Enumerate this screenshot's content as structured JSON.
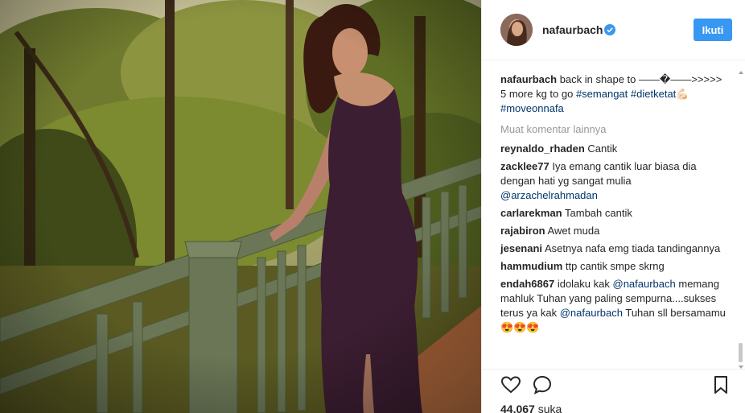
{
  "post": {
    "username": "nafaurbach",
    "follow_label": "Ikuti",
    "likes_count": "44,067",
    "likes_label": "suka"
  },
  "caption": {
    "user": "nafaurbach",
    "text": "back in shape to ——�——>>>>> 5 more kg to go",
    "tags": [
      "#semangat",
      "#dietketat",
      "#moveonnafa"
    ]
  },
  "load_more_label": "Muat komentar lainnya",
  "comments": [
    {
      "user": "reynaldo_rhaden",
      "text": "Cantik"
    },
    {
      "user": "zacklee77",
      "text": "Iya emang cantik luar biasa dia dengan hati yg sangat mulia",
      "mention": "@arzachelrahmadan"
    },
    {
      "user": "carlarekman",
      "text": "Tambah cantik"
    },
    {
      "user": "rajabiron",
      "text": "Awet muda"
    },
    {
      "user": "jesenani",
      "text": "Asetnya nafa emg tiada tandingannya"
    },
    {
      "user": "hammudium",
      "text": "ttp cantik smpe skrng"
    },
    {
      "user": "endah6867",
      "text_a": "idolaku kak",
      "mention_a": "@nafaurbach",
      "text_b": "memang mahluk Tuhan yang paling sempurna....sukses terus ya kak",
      "mention_b": "@nafaurbach",
      "text_c": "Tuhan sll bersamamu😍😍😍"
    }
  ],
  "icons": {
    "verified": "verified-badge-icon",
    "like": "heart-icon",
    "comment": "comment-bubble-icon",
    "save": "bookmark-icon"
  },
  "colors": {
    "accent": "#3897f0",
    "link": "#003569",
    "muted": "#999999",
    "text": "#262626"
  }
}
